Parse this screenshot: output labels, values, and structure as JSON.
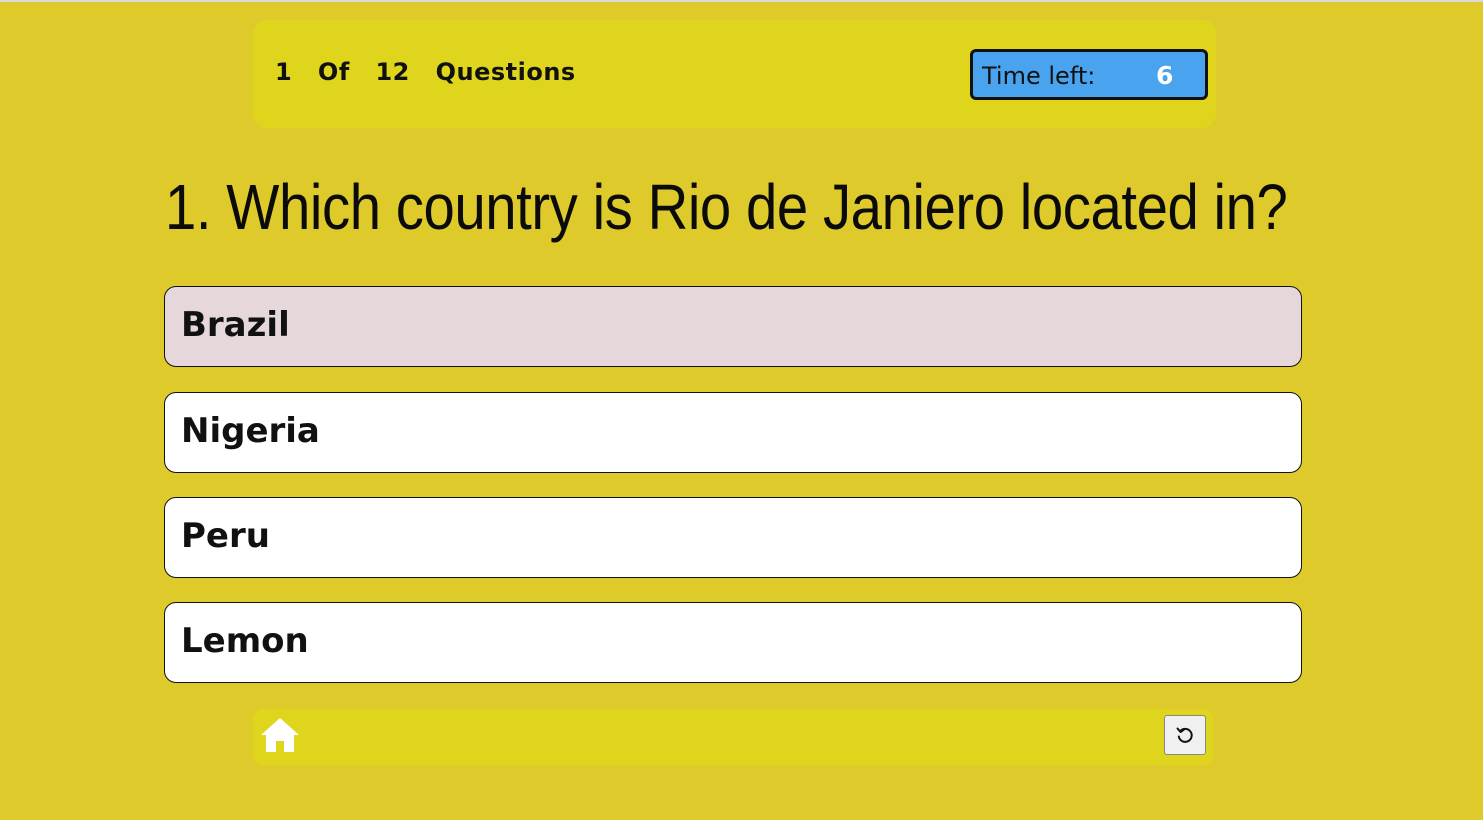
{
  "header": {
    "question_counter": "1  Of  12  Questions",
    "timer_label": "Time left:",
    "timer_value": "6"
  },
  "question": {
    "text": "1. Which country is Rio de Janiero located in?"
  },
  "options": [
    {
      "label": "Brazil",
      "selected": true
    },
    {
      "label": "Nigeria",
      "selected": false
    },
    {
      "label": "Peru",
      "selected": false
    },
    {
      "label": "Lemon",
      "selected": false
    }
  ],
  "footer": {
    "home_icon": "home-icon",
    "restart_icon": "restart-icon"
  },
  "colors": {
    "background": "#DFCA2B",
    "panel": "#DED51C",
    "timer": "#4AA3EE",
    "selected_option": "#E6D8DA"
  }
}
